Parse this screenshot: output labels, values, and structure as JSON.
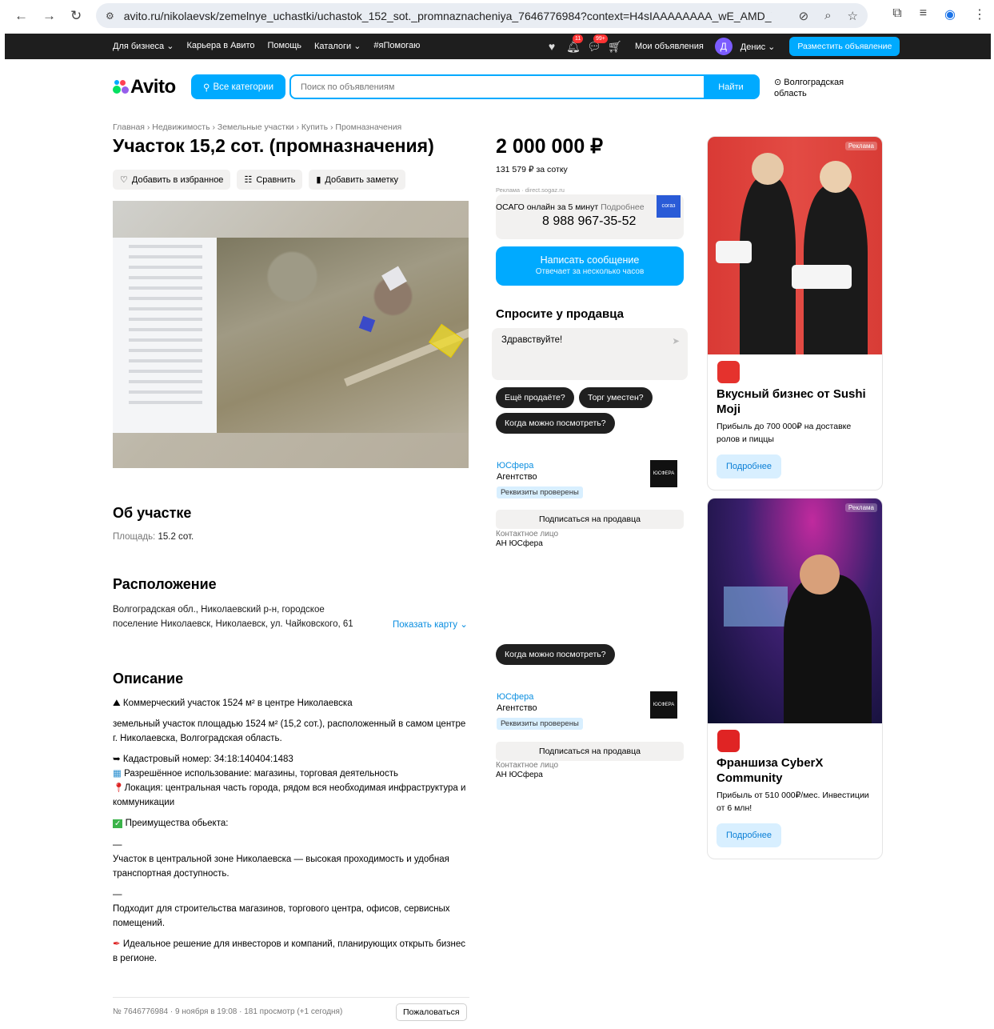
{
  "browser": {
    "url": "avito.ru/nikolaevsk/zemelnye_uchastki/uchastok_152_sot._promnaznacheniya_7646776984?context=H4sIAAAAAAAA_wE_AMD_YToyO..."
  },
  "topbar": {
    "links": [
      "Для бизнеса ⌄",
      "Карьера в Авито",
      "Помощь",
      "Каталоги ⌄",
      "#яПомогаю"
    ],
    "badges": {
      "notifications": "11",
      "messages": "99+"
    },
    "my_ads": "Мои объявления",
    "avatar_letter": "Д",
    "user_name": "Денис ⌄",
    "post_button": "Разместить объявление"
  },
  "header": {
    "logo": "Avito",
    "categories_button": "Все категории",
    "search_placeholder": "Поиск по объявлениям",
    "search_button": "Найти",
    "region": "Волгоградская область"
  },
  "breadcrumbs": "Главная › Недвижимость › Земельные участки › Купить › Промназначения",
  "title": "Участок 15,2 сот. (промназначения)",
  "actions": {
    "favorite": "Добавить в избранное",
    "compare": "Сравнить",
    "note": "Добавить заметку"
  },
  "about": {
    "heading": "Об участке",
    "area_label": "Площадь:",
    "area_value": "15.2 сот."
  },
  "location": {
    "heading": "Расположение",
    "address_line1": "Волгоградская обл., Николаевский р-н, городское",
    "address_line2": "поселение Николаевск, Николаевск, ул. Чайковского, 61",
    "show_map": "Показать карту ⌄"
  },
  "description": {
    "heading": "Описание",
    "p1": "Коммерческий участок 1524 м² в центре Николаевска",
    "p2": "земельный участок площадью 1524 м² (15,2 сот.), расположенный в самом центре г. Николаевска, Волгоградская область.",
    "p3": "Кадастровый номер: 34:18:140404:1483",
    "p4": "Разрешённое использование: магазины, торговая деятельность",
    "p5": "Локация: центральная часть города, рядом вся необходимая инфраструктура и коммуникации",
    "p6": "Преимущества обьекта:",
    "dash1": "—",
    "p7": "Участок в центральной зоне Николаевска — высокая проходимость и удобная транспортная доступность.",
    "dash2": "—",
    "p8": "Подходит для строительства магазинов, торгового центра, офисов, сервисных помещений.",
    "p9": "Идеальное решение для инвесторов и компаний, планирующих открыть бизнес в регионе."
  },
  "footer": {
    "meta": "№ 7646776984 · 9 ноября в 19:08 · 181 просмотр (+1 сегодня)",
    "report": "Пожаловаться"
  },
  "price": {
    "value": "2 000 000 ₽",
    "per_sotka": "131 579 ₽ за сотку"
  },
  "promo": {
    "label": "Реклама · direct.sogaz.ru",
    "text": "ОСАГО онлайн за 5 минут",
    "more": "Подробнее",
    "phone": "8 988 967-35-52",
    "brand": "согаз"
  },
  "write": {
    "title": "Написать сообщение",
    "subtitle": "Отвечает за несколько часов"
  },
  "ask": {
    "heading": "Спросите у продавца",
    "message": "Здравствуйте!",
    "chip1": "Ещё продаёте?",
    "chip2": "Торг уместен?",
    "chip3": "Когда можно посмотреть?"
  },
  "seller": {
    "name": "ЮСфера",
    "type": "Агентство",
    "verified": "Реквизиты проверены",
    "subscribe": "Подписаться на продавца",
    "contact_label": "Контактное лицо",
    "contact_name": "АН ЮСфера",
    "logo_text": "ЮСФЕРА"
  },
  "ads": [
    {
      "label": "Реклама",
      "title": "Вкусный бизнес от Sushi Moji",
      "text": "Прибыль до 700 000₽ на доставке ролов и пиццы",
      "button": "Подробнее",
      "brand_color": "#e5322d"
    },
    {
      "label": "Реклама",
      "title": "Франшиза CyberX Community",
      "text": "Прибыль от 510 000₽/мес. Инвестиции от 6 млн!",
      "button": "Подробнее",
      "brand_color": "#e02424"
    }
  ],
  "colors": {
    "accent": "#00aaff",
    "dark_bar": "#1e1e1e",
    "link": "#0a8ee0"
  }
}
